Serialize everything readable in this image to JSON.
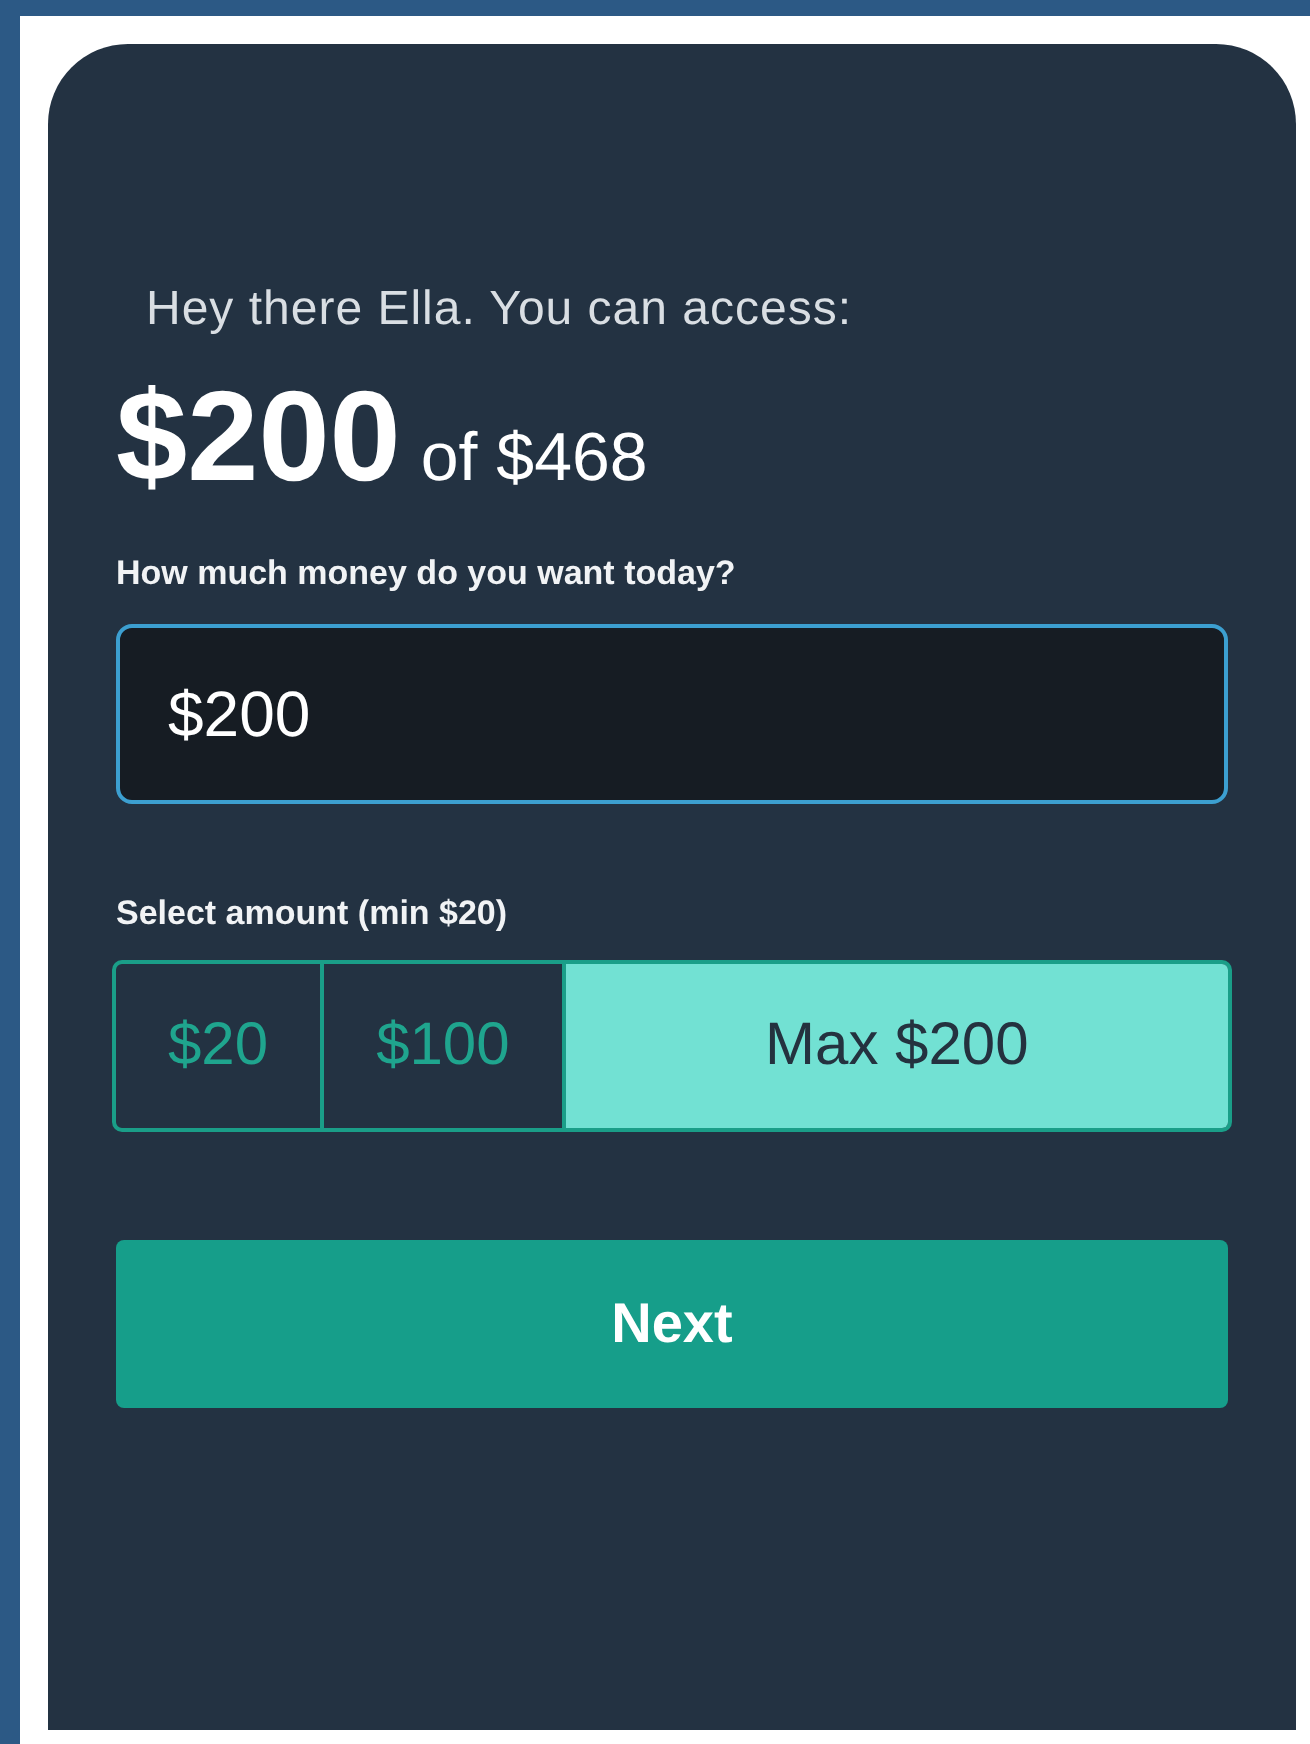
{
  "greeting": "Hey there Ella. You can access:",
  "available": {
    "amount": "$200",
    "total": "of $468"
  },
  "amount_field": {
    "label": "How much money do you want today?",
    "value": "$200"
  },
  "select_amount": {
    "label": "Select amount (min $20)",
    "options": [
      {
        "label": "$20",
        "selected": false
      },
      {
        "label": "$100",
        "selected": false
      },
      {
        "label": "Max $200",
        "selected": true
      }
    ]
  },
  "buttons": [
    "Next"
  ]
}
